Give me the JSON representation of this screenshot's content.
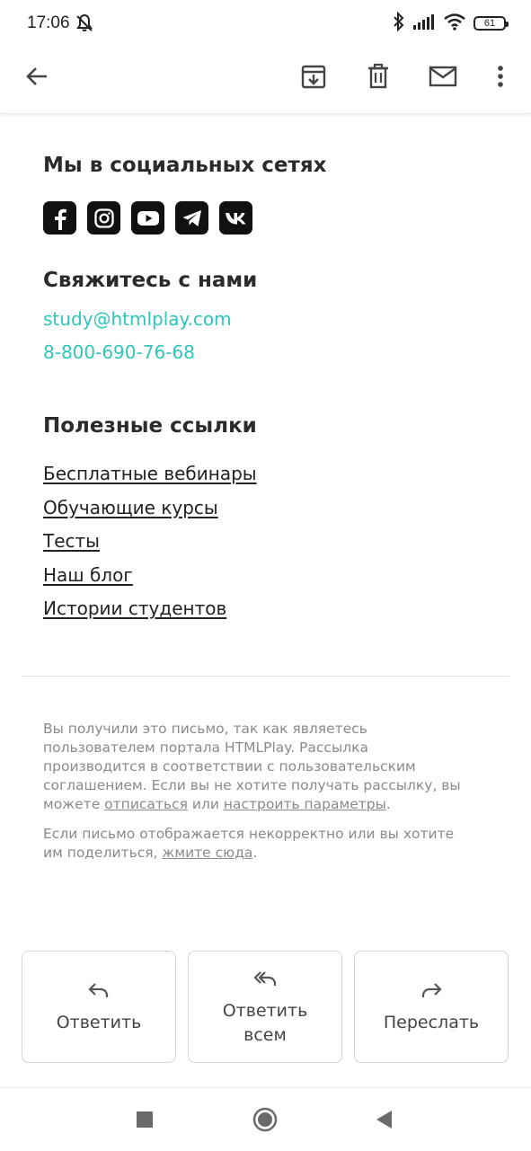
{
  "status_bar": {
    "time": "17:06",
    "battery": "61",
    "icons": [
      "muted-bell-icon",
      "bluetooth-icon",
      "signal-icon",
      "wifi-icon",
      "battery-icon"
    ]
  },
  "toolbar": {
    "icons": [
      "back-arrow-icon",
      "archive-icon",
      "delete-icon",
      "mark-unread-icon",
      "more-vert-icon"
    ]
  },
  "email": {
    "social": {
      "heading": "Мы в социальных сетях",
      "networks": [
        "facebook-icon",
        "instagram-icon",
        "youtube-icon",
        "telegram-icon",
        "vk-icon"
      ]
    },
    "contact": {
      "heading": "Свяжитесь с нами",
      "email": "study@htmlplay.com",
      "phone": "8-800-690-76-68"
    },
    "useful": {
      "heading": "Полезные ссылки",
      "links": [
        "Бесплатные вебинары",
        "Обучающие курсы",
        "Тесты",
        "Наш блог",
        "Истории студентов"
      ]
    },
    "footer": {
      "p1_text": "Вы получили это письмо, так как являетесь пользователем портала HTMLPlay. Рассылка производится в соответствии с пользовательским соглашением. Если вы не хотите получать рассылку, вы можете ",
      "p1_link1": "отписаться",
      "p1_mid": " или ",
      "p1_link2": "настроить параметры",
      "p1_end": ".",
      "p2_text": "Если письмо отображается некорректно или вы хотите им поделиться, ",
      "p2_link": "жмите сюда",
      "p2_end": "."
    }
  },
  "actions": {
    "reply": "Ответить",
    "reply_all_line1": "Ответить",
    "reply_all_line2": "всем",
    "forward": "Переслать"
  },
  "colors": {
    "link_accent": "#2fc6b9",
    "text": "#222222",
    "muted": "#8a8a8a"
  }
}
